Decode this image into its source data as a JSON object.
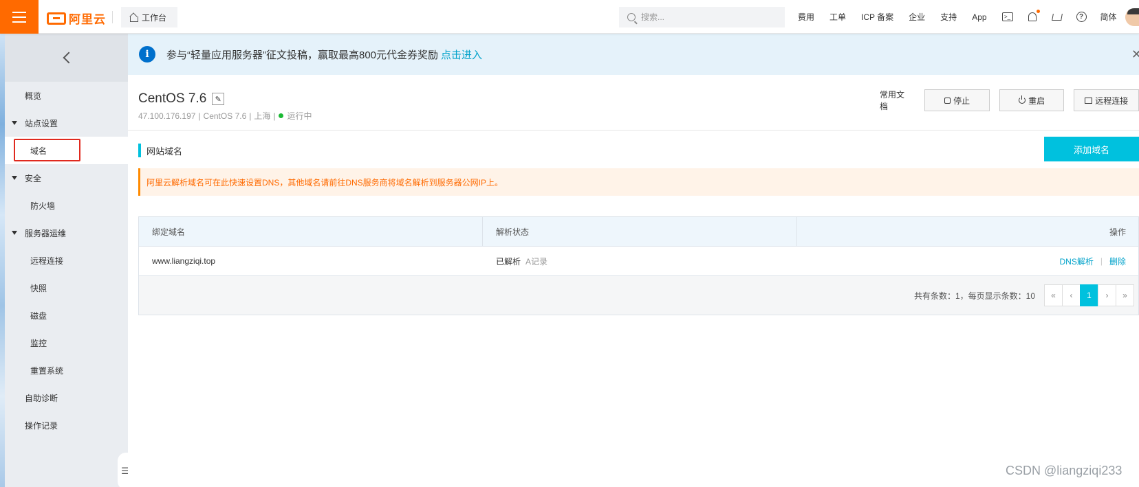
{
  "topbar": {
    "brand": "阿里云",
    "workbench": "工作台",
    "search_placeholder": "搜索...",
    "nav": [
      "费用",
      "工单",
      "ICP 备案",
      "企业",
      "支持",
      "App"
    ],
    "lang": "简体",
    "accent": "#ff6a00"
  },
  "sidebar": {
    "items": [
      {
        "label": "概览"
      },
      {
        "label": "站点设置"
      },
      {
        "label": "域名"
      },
      {
        "label": "安全"
      },
      {
        "label": "防火墙"
      },
      {
        "label": "服务器运维"
      },
      {
        "label": "远程连接"
      },
      {
        "label": "快照"
      },
      {
        "label": "磁盘"
      },
      {
        "label": "监控"
      },
      {
        "label": "重置系统"
      },
      {
        "label": "自助诊断"
      },
      {
        "label": "操作记录"
      }
    ]
  },
  "notice": {
    "text": "参与“轻量应用服务器”征文投稿，赢取最高800元代金券奖励",
    "link": "点击进入"
  },
  "instance": {
    "name": "CentOS 7.6",
    "ip": "47.100.176.197",
    "os": "CentOS 7.6",
    "region": "上海",
    "status": "运行中",
    "sep": "|"
  },
  "actions": {
    "docs": "常用文档",
    "stop": "停止",
    "restart": "重启",
    "remote": "远程连接"
  },
  "section": {
    "title": "网站域名",
    "add_button": "添加域名",
    "tip": "阿里云解析域名可在此快速设置DNS，其他域名请前往DNS服务商将域名解析到服务器公网IP上。"
  },
  "table": {
    "headers": [
      "绑定域名",
      "解析状态",
      "操作"
    ],
    "rows": [
      {
        "domain": "www.liangziqi.top",
        "status": "已解析",
        "record": "A记录",
        "op_dns": "DNS解析",
        "op_sep": "|",
        "op_delete": "删除"
      }
    ],
    "total": "共有条数：1，每页显示条数：10",
    "pager": [
      "«",
      "‹",
      "1",
      "›",
      "»"
    ]
  },
  "watermark": "CSDN @liangziqi233",
  "colors": {
    "primary": "#00c1de",
    "warning": "#ff6a00",
    "link": "#00a2ca",
    "highlight": "#e0291e"
  }
}
